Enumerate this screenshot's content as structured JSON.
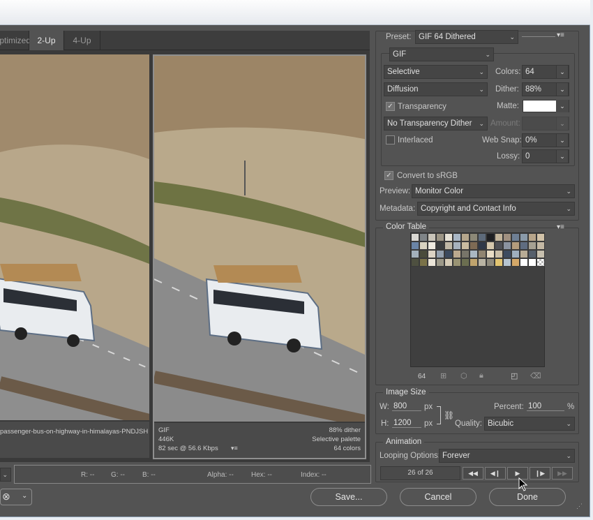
{
  "tabs": {
    "optimized": "Optimized",
    "two_up": "2-Up",
    "four_up": "4-Up"
  },
  "left_pane": {
    "filename": "passenger-bus-on-highway-in-himalayas-PNDJSH"
  },
  "right_pane": {
    "format": "GIF",
    "size": "446K",
    "time": "82 sec @ 56.6 Kbps",
    "dither": "88% dither",
    "palette": "Selective palette",
    "colors": "64 colors"
  },
  "status": {
    "r": "R: --",
    "g": "G: --",
    "b": "B: --",
    "alpha": "Alpha: --",
    "hex": "Hex: --",
    "index": "Index: --"
  },
  "preset": {
    "label": "Preset:",
    "value": "GIF 64 Dithered"
  },
  "format": "GIF",
  "reduction": "Selective",
  "colors": {
    "label": "Colors:",
    "value": "64"
  },
  "dither_algo": "Diffusion",
  "dither": {
    "label": "Dither:",
    "value": "88%"
  },
  "transparency": {
    "label": "Transparency",
    "checked": true
  },
  "matte": {
    "label": "Matte:",
    "color": "#ffffff"
  },
  "trans_dither": "No Transparency Dither",
  "amount": {
    "label": "Amount:",
    "value": ""
  },
  "interlaced": {
    "label": "Interlaced",
    "checked": false
  },
  "web_snap": {
    "label": "Web Snap:",
    "value": "0%"
  },
  "lossy": {
    "label": "Lossy:",
    "value": "0"
  },
  "convert_srgb": {
    "label": "Convert to sRGB",
    "checked": true
  },
  "preview": {
    "label": "Preview:",
    "value": "Monitor Color"
  },
  "metadata": {
    "label": "Metadata:",
    "value": "Copyright and Contact Info"
  },
  "color_table": {
    "title": "Color Table",
    "count": "64",
    "swatches": [
      "#d9d7d2",
      "#7f8487",
      "#c8c3b8",
      "#9b9484",
      "#e6e1d5",
      "#a8b6c5",
      "#b5a68c",
      "#8c8877",
      "#5d6a7a",
      "#1e1f22",
      "#c2b49b",
      "#a09080",
      "#6e7f94",
      "#8a9aa9",
      "#b7a58a",
      "#d1c2a8",
      "#6a84a6",
      "#d8d2c0",
      "#eeeae0",
      "#3a3d3f",
      "#bfb7a5",
      "#a7b2bd",
      "#c9bba0",
      "#7e6b54",
      "#2f3848",
      "#d5c7ad",
      "#4f5055",
      "#8b93a0",
      "#b39c7c",
      "#5f6c80",
      "#a6a092",
      "#c4b8a4",
      "#a3b0bc",
      "#4a4b3a",
      "#dcd3c4",
      "#94a0ae",
      "#3c4a5e",
      "#bba98f",
      "#777469",
      "#aab7c2",
      "#908470",
      "#e8dcc4",
      "#cbbfa8",
      "#3d4b60",
      "#9faebd",
      "#b8ab95",
      "#565f6b",
      "#c7bfae",
      "#4e5040",
      "#7a7248",
      "#ebe5d8",
      "#9c9888",
      "#d5cbb6",
      "#9a9474",
      "#6b6e50",
      "#c0a46d",
      "#b9b3a3",
      "#8f8a7c",
      "#e2c470",
      "#b5c3cf",
      "#d4a868",
      "#ffffff",
      "#ffffff",
      "#cccccc"
    ]
  },
  "image_size": {
    "title": "Image Size",
    "w_label": "W:",
    "w": "800",
    "h_label": "H:",
    "h": "1200",
    "unit": "px",
    "percent_label": "Percent:",
    "percent": "100",
    "percent_unit": "%",
    "quality_label": "Quality:",
    "quality": "Bicubic"
  },
  "animation": {
    "title": "Animation",
    "looping_label": "Looping Options:",
    "looping": "Forever",
    "frame": "26 of 26"
  },
  "buttons": {
    "save": "Save...",
    "cancel": "Cancel",
    "done": "Done"
  }
}
